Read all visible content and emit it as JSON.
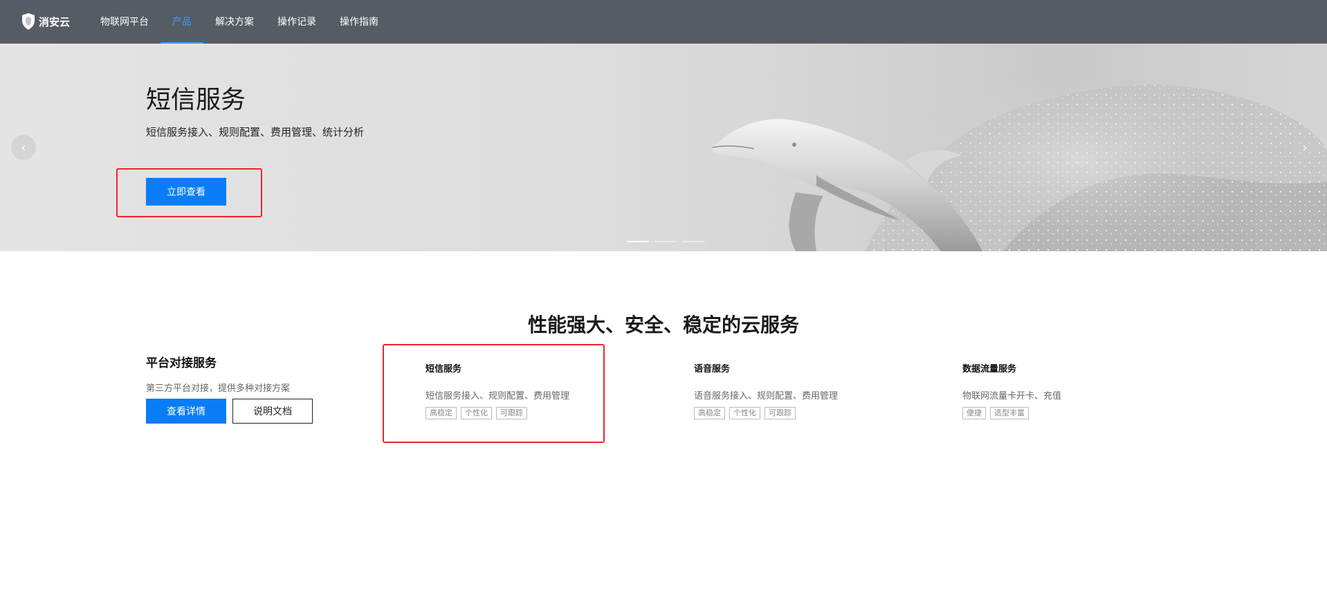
{
  "nav": {
    "logo_text": "消安云",
    "items": [
      {
        "label": "物联网平台",
        "active": false
      },
      {
        "label": "产品",
        "active": true
      },
      {
        "label": "解决方案",
        "active": false
      },
      {
        "label": "操作记录",
        "active": false
      },
      {
        "label": "操作指南",
        "active": false
      }
    ]
  },
  "banner": {
    "title": "短信服务",
    "subtitle": "短信服务接入、规则配置、费用管理、统计分析",
    "button_label": "立即查看",
    "prev_arrow": "‹",
    "next_arrow": "›",
    "slides": 3,
    "active_slide": 1
  },
  "section": {
    "title": "性能强大、安全、稳定的云服务",
    "platform": {
      "title": "平台对接服务",
      "desc": "第三方平台对接，提供多种对接方案",
      "primary_button": "查看详情",
      "secondary_button": "说明文档"
    },
    "cards": [
      {
        "title": "短信服务",
        "desc": "短信服务接入、规则配置、费用管理",
        "tags": [
          "高稳定",
          "个性化",
          "可跟踪"
        ]
      },
      {
        "title": "语音服务",
        "desc": "语音服务接入、规则配置、费用管理",
        "tags": [
          "高稳定",
          "个性化",
          "可跟踪"
        ]
      },
      {
        "title": "数据流量服务",
        "desc": "物联网流量卡开卡、充值",
        "tags": [
          "便捷",
          "选型丰富"
        ]
      }
    ]
  },
  "colors": {
    "nav_bg": "#565c63",
    "accent": "#0a7cf5",
    "nav_active": "#3d9bff",
    "highlight_box": "#f0242a"
  }
}
